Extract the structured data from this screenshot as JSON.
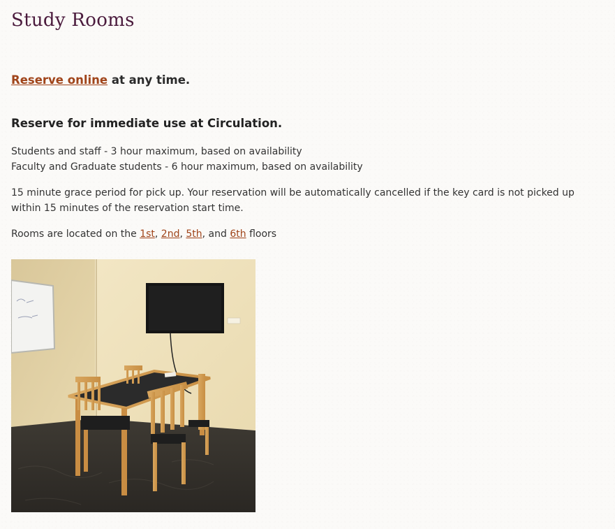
{
  "page": {
    "title": "Study Rooms"
  },
  "reserve_online": {
    "link_label": "Reserve online",
    "trailing_text": " at any time."
  },
  "immediate": {
    "heading": "Reserve for immediate use at Circulation."
  },
  "policies": {
    "students_staff": "Students and staff - 3 hour maximum, based on availability",
    "faculty_grad": "Faculty and Graduate students - 6 hour maximum, based on availability"
  },
  "grace": {
    "text": "15 minute grace period for pick up. Your reservation will be automatically cancelled if the key card is not picked up within 15 minutes of the reservation start time."
  },
  "rooms": {
    "prefix": "Rooms are located on the ",
    "floors": [
      "1st",
      "2nd",
      "5th",
      "6th"
    ],
    "sep1": ", ",
    "sep2": ", ",
    "sep3": ", and ",
    "suffix": " floors"
  },
  "photo": {
    "description_icon": "study-room-photo"
  },
  "colors": {
    "title": "#4a1a3c",
    "link": "#a0441a",
    "text": "#333333",
    "background": "#fbfaf8"
  }
}
